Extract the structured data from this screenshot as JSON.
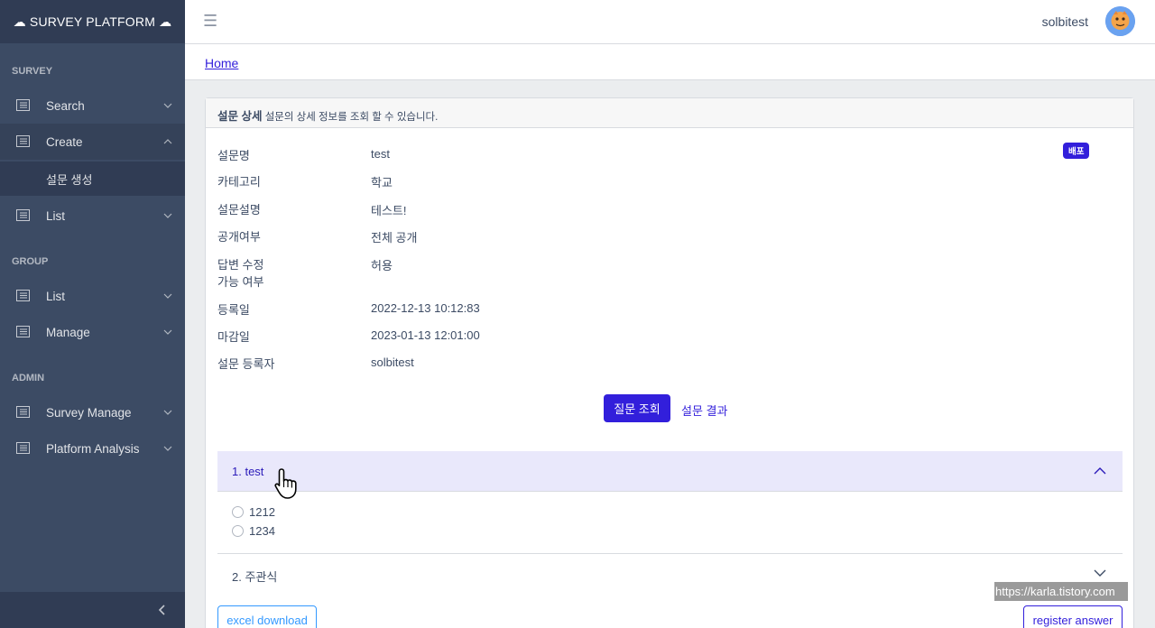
{
  "sidebar": {
    "brand": "☁ SURVEY PLATFORM ☁",
    "sections": {
      "survey": "SURVEY",
      "group": "GROUP",
      "admin": "ADMIN"
    },
    "items": {
      "search": "Search",
      "create": "Create",
      "create_sub": "설문 생성",
      "survey_list": "List",
      "group_list": "List",
      "group_manage": "Manage",
      "survey_manage": "Survey Manage",
      "platform_analysis": "Platform Analysis"
    }
  },
  "header": {
    "menu_icon": "hamburger-icon",
    "username": "solbitest"
  },
  "breadcrumb": "Home",
  "card": {
    "title": "설문 상세",
    "subtitle": "설문의 상세 정보를 조회 할 수 있습니다.",
    "badge": "배포",
    "details": {
      "name_label": "설문명",
      "name_value": "test",
      "category_label": "카테고리",
      "category_value": "학교",
      "desc_label": "설문설명",
      "desc_value": "테스트!",
      "public_label": "공개여부",
      "public_value": "전체 공개",
      "edit_label_1": "답변 수정",
      "edit_label_2": "가능 여부",
      "edit_value": "허용",
      "created_label": "등록일",
      "created_value": "2022-12-13 10:12:83",
      "deadline_label": "마감일",
      "deadline_value": "2023-01-13 12:01:00",
      "author_label": "설문 등록자",
      "author_value": "solbitest"
    },
    "buttons": {
      "view_questions": "질문 조회",
      "view_results": "설문 결과",
      "excel_download": "excel download",
      "register_answer": "register answer"
    },
    "questions": {
      "q1_title": "1. test",
      "q1_opt1": "1212",
      "q1_opt2": "1234",
      "q2_title": "2. 주관식"
    }
  },
  "watermark": "https://karla.tistory.com",
  "colors": {
    "sidebar": "#3c4b64",
    "primary": "#321fdb",
    "info": "#3399ff"
  }
}
